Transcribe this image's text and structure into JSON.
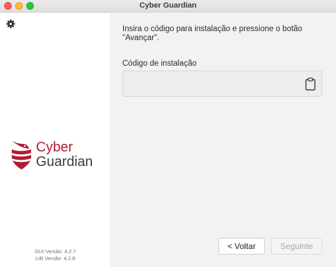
{
  "window": {
    "title": "Cyber Guardian"
  },
  "sidebar": {
    "brand": {
      "line1": "Cyber",
      "line2": "Guardian",
      "primary_color": "#b31b34",
      "secondary_color": "#3a3a3a"
    },
    "versions": {
      "gui": "GUI Versão: 4.2.7",
      "lib": "LIB Versão: 4.2.8"
    }
  },
  "main": {
    "instruction": "Insira o código para instalação e pressione o botão \"Avançar\".",
    "code_label": "Código de instalação",
    "code_value": "",
    "paste_icon": "clipboard-icon"
  },
  "footer": {
    "back_label": "Voltar",
    "back_icon": "chevron-left-icon",
    "next_label": "Seguinte",
    "next_enabled": false
  }
}
